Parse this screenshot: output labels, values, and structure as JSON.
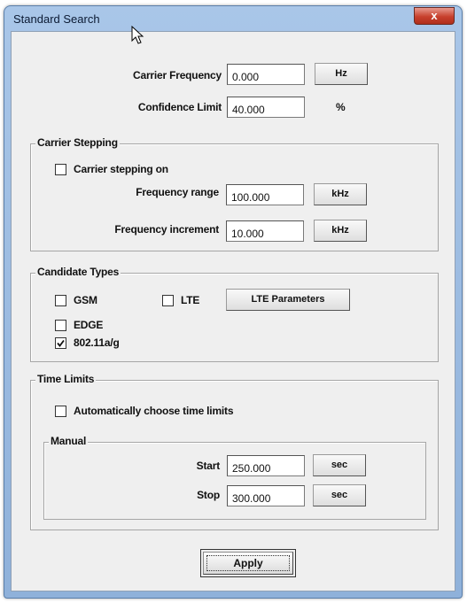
{
  "window": {
    "title": "Standard Search",
    "close_label": "x"
  },
  "carrier": {
    "frequency_label": "Carrier Frequency",
    "frequency_value": "0.000",
    "frequency_unit_button": "Hz",
    "confidence_label": "Confidence Limit",
    "confidence_value": "40.000",
    "confidence_unit": "%"
  },
  "stepping": {
    "group_label": "Carrier Stepping",
    "checkbox_label": "Carrier stepping on",
    "checkbox_checked": false,
    "range_label": "Frequency range",
    "range_value": "100.000",
    "range_unit_button": "kHz",
    "increment_label": "Frequency increment",
    "increment_value": "10.000",
    "increment_unit_button": "kHz"
  },
  "candidates": {
    "group_label": "Candidate Types",
    "gsm_label": "GSM",
    "gsm_checked": false,
    "lte_label": "LTE",
    "lte_checked": false,
    "lte_params_button": "LTE Parameters",
    "edge_label": "EDGE",
    "edge_checked": false,
    "wifi_label": "802.11a/g",
    "wifi_checked": true
  },
  "time_limits": {
    "group_label": "Time Limits",
    "auto_label": "Automatically choose time limits",
    "auto_checked": false,
    "manual_group_label": "Manual",
    "start_label": "Start",
    "start_value": "250.000",
    "start_unit_button": "sec",
    "stop_label": "Stop",
    "stop_value": "300.000",
    "stop_unit_button": "sec"
  },
  "apply_label": "Apply"
}
